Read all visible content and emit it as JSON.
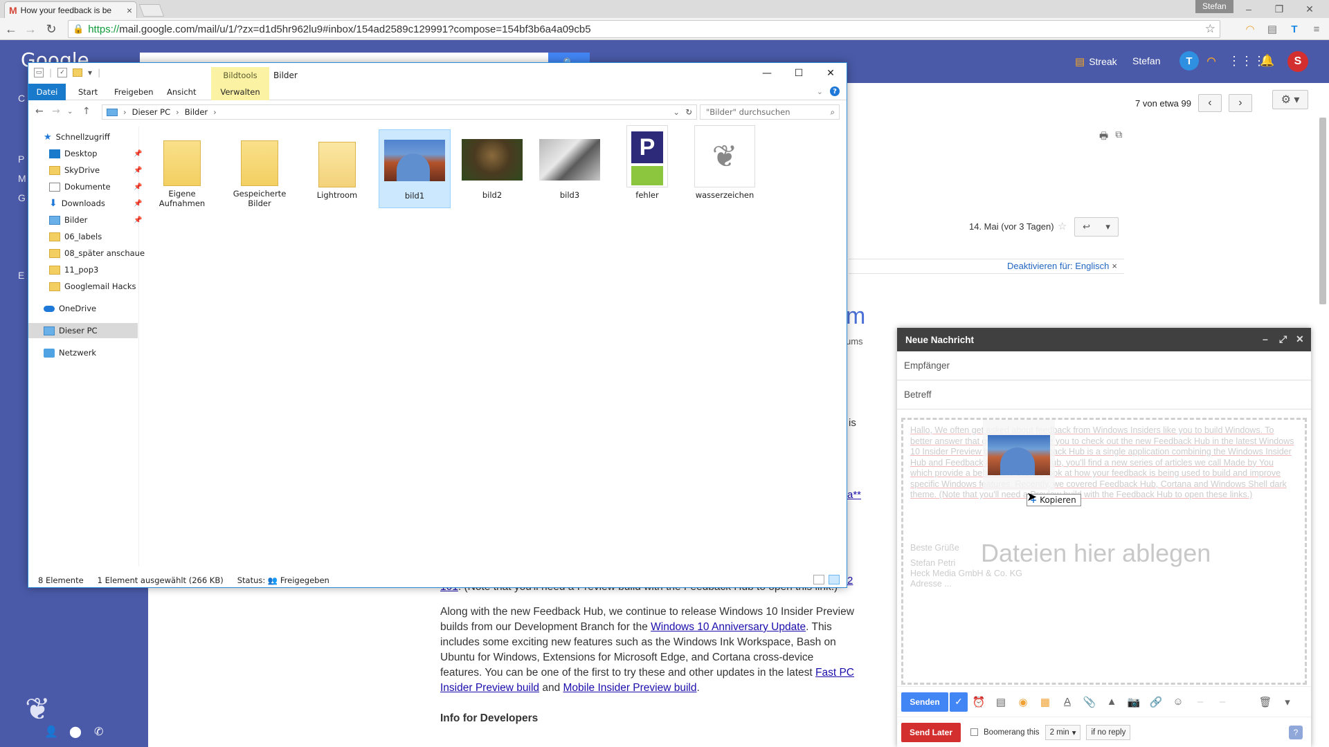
{
  "browser": {
    "tab_title": "How your feedback is be",
    "profile_name": "Stefan",
    "url_scheme": "https://",
    "url_rest": "mail.google.com/mail/u/1/?zx=d1d5hr962lu9#inbox/154ad2589c129991?compose=154bf3b6a4a09cb5"
  },
  "gmail": {
    "logo": "Google",
    "streak_label": "Streak",
    "user_name": "Stefan",
    "avatar_letter": "S",
    "pager_text": "7 von etwa 99",
    "date_text": "14. Mai (vor 3 Tagen)",
    "translate_text": "Deaktivieren für: Englisch",
    "partial_big": "m",
    "partial_small": "ums",
    "frag_is": "is",
    "frag_a": "a**",
    "frag_2": "2",
    "left_letters": [
      "C",
      "P",
      "M",
      "G",
      "E"
    ]
  },
  "article": {
    "p1_link": "101",
    "p1_text": ". (Note that you'll need a Preview build with the Feedback Hub to open this link.)",
    "p2_a": "Along with the new Feedback Hub, we continue to release Windows 10 Insider Preview builds from our Development Branch for the ",
    "p2_link1": "Windows 10 Anniversary Update",
    "p2_b": ". This includes some exciting new features such as the Windows Ink Workspace, Bash on Ubuntu for Windows, Extensions for Microsoft Edge, and Cortana cross-device features. You can be one of the first to try these and other updates in the latest ",
    "p2_link2": "Fast PC Insider Preview build",
    "p2_c": " and ",
    "p2_link3": "Mobile Insider Preview build",
    "p2_d": ".",
    "h_dev": "Info for Developers"
  },
  "compose": {
    "title": "Neue Nachricht",
    "to_label": "Empfänger",
    "subject_label": "Betreff",
    "ghost_body": "Hallo, We often get asked about feedback from Windows Insiders like you to build Windows. To better answer that question, we invite you to check out the new Feedback Hub in the latest Windows 10 Insider Preview builds. The Feedback Hub is a single application combining the Windows Insider Hub and Feedback App. Inside the Hub, you'll find a new series of articles we call Made by You which provide a behind-the-scenes look at how your feedback is being used to build and improve specific Windows features. Recently, we covered Feedback Hub, Cortana and Windows Shell dark theme. (Note that you'll need a Preview build with the Feedback Hub to open these links.)",
    "ghost_sig1": "Beste Grüße",
    "ghost_sig2": "Stefan Petri",
    "ghost_sig3": "Heck Media GmbH & Co. KG",
    "ghost_sig4": "Adresse ...",
    "drop_message": "Dateien hier ablegen",
    "copy_label": "Kopieren",
    "send_label": "Senden",
    "send_later_label": "Send Later",
    "boomerang_label": "Boomerang this",
    "boomerang_time": "2 min",
    "boomerang_cond": "if no reply"
  },
  "explorer": {
    "context_tab": "Bildtools",
    "title": "Bilder",
    "ribbon_tabs": [
      "Datei",
      "Start",
      "Freigeben",
      "Ansicht",
      "Verwalten"
    ],
    "breadcrumb": [
      "Dieser PC",
      "Bilder"
    ],
    "search_placeholder": "\"Bilder\" durchsuchen",
    "nav": {
      "quick_access": "Schnellzugriff",
      "pinned": [
        "Desktop",
        "SkyDrive",
        "Dokumente",
        "Downloads",
        "Bilder"
      ],
      "folders": [
        "06_labels",
        "08_später anschaue",
        "11_pop3",
        "Googlemail Hacks"
      ],
      "onedrive": "OneDrive",
      "this_pc": "Dieser PC",
      "network": "Netzwerk"
    },
    "files": [
      {
        "name": "Eigene Aufnahmen",
        "kind": "folder"
      },
      {
        "name": "Gespeicherte Bilder",
        "kind": "folder"
      },
      {
        "name": "Lightroom",
        "kind": "folder"
      },
      {
        "name": "bild1",
        "kind": "photo"
      },
      {
        "name": "bild2",
        "kind": "photo"
      },
      {
        "name": "bild3",
        "kind": "photo"
      },
      {
        "name": "fehler",
        "kind": "image"
      },
      {
        "name": "wasserzeichen",
        "kind": "image"
      }
    ],
    "status_count": "8 Elemente",
    "status_selected": "1 Element ausgewählt (266 KB)",
    "status_label": "Status:",
    "status_value": "Freigegeben"
  }
}
